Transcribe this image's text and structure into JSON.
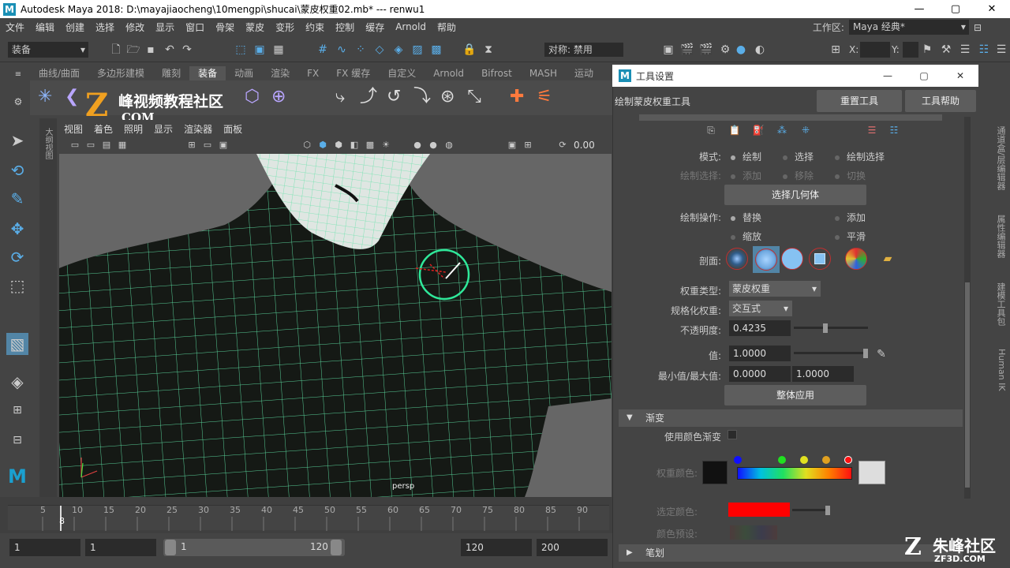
{
  "window": {
    "title": "Autodesk Maya 2018: D:\\mayajiaocheng\\10mengpi\\shucai\\蒙皮权重02.mb*   ---   renwu1",
    "logo": "M",
    "buttons": [
      "—",
      "▢",
      "✕"
    ]
  },
  "menu": [
    "文件",
    "编辑",
    "创建",
    "选择",
    "修改",
    "显示",
    "窗口",
    "骨架",
    "蒙皮",
    "变形",
    "约束",
    "控制",
    "缓存",
    "Arnold",
    "帮助"
  ],
  "workspace": {
    "label": "工作区:",
    "value": "Maya 经典*"
  },
  "status": {
    "mode": "装备",
    "symmetry": "对称: 禁用",
    "x_label": "X:",
    "y_label": "Y:"
  },
  "shelf": {
    "tabs": [
      "曲线/曲面",
      "多边形建模",
      "雕刻",
      "装备",
      "动画",
      "渲染",
      "FX",
      "FX 缓存",
      "自定义",
      "Arnold",
      "Bifrost",
      "MASH",
      "运动"
    ],
    "active": "装备"
  },
  "watermark_top": {
    "text1": "峰视频教程社区",
    "text2": "COM"
  },
  "outliner_label": "大纲视图",
  "viewport": {
    "menu": [
      "视图",
      "着色",
      "照明",
      "显示",
      "渲染器",
      "面板"
    ],
    "value": "0.00",
    "camera": "persp"
  },
  "timeline": {
    "ticks": [
      "5",
      "10",
      "15",
      "20",
      "25",
      "30",
      "35",
      "40",
      "45",
      "50",
      "55",
      "60",
      "65",
      "70",
      "75",
      "80",
      "85",
      "90"
    ],
    "current": "8"
  },
  "range": {
    "start": "1",
    "playback_start": "1",
    "slider_start": "1",
    "slider_end": "120",
    "playback_end": "120",
    "end": "200"
  },
  "tool_settings": {
    "window_title": "工具设置",
    "logo": "M",
    "buttons": [
      "—",
      "▢",
      "✕"
    ],
    "tool_name": "绘制蒙皮权重工具",
    "reset_button": "重置工具",
    "help_button": "工具帮助",
    "mode_label": "模式:",
    "mode_options": [
      "绘制",
      "选择",
      "绘制选择"
    ],
    "paint_select_label": "绘制选择:",
    "paint_select_options": [
      "添加",
      "移除",
      "切换"
    ],
    "select_geometry": "选择几何体",
    "paint_op_label": "绘制操作:",
    "paint_ops": [
      "替换",
      "添加",
      "缩放",
      "平滑"
    ],
    "profile_label": "剖面:",
    "weight_type_label": "权重类型:",
    "weight_type": "蒙皮权重",
    "normalize_label": "规格化权重:",
    "normalize": "交互式",
    "opacity_label": "不透明度:",
    "opacity": "0.4235",
    "opacity_level": 0.42,
    "value_label": "值:",
    "value": "1.0000",
    "value_level": 1.0,
    "minmax_label": "最小值/最大值:",
    "min": "0.0000",
    "max": "1.0000",
    "flood_button": "整体应用",
    "gradient_section": "渐变",
    "use_color_ramp": "使用颜色渐变",
    "weight_color_label": "权重颜色:",
    "selected_color_label": "选定颜色:",
    "color_preset_label": "颜色预设:",
    "stroke_section": "笔划",
    "selected_color": "#ff0000"
  },
  "right_dock": [
    "通道盒/层编辑器",
    "属性编辑器",
    "建模工具包",
    "Human IK"
  ],
  "watermark_bottom": {
    "text1": "朱峰社区",
    "text2": "ZF3D.COM"
  }
}
